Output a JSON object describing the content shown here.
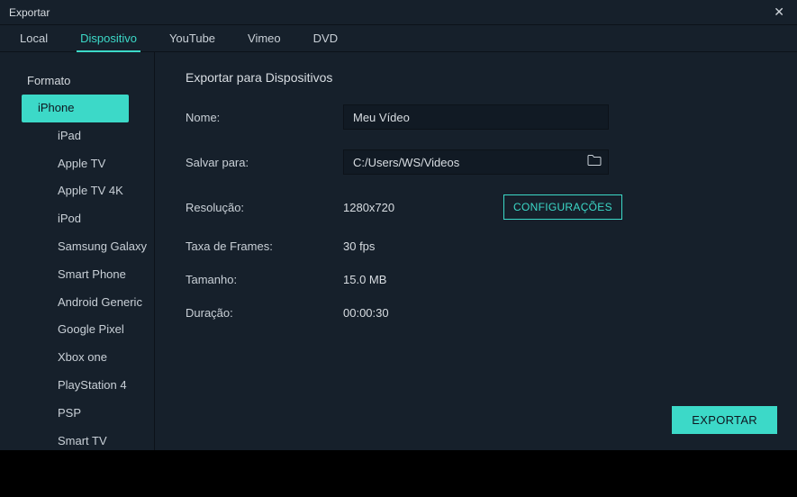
{
  "window": {
    "title": "Exportar"
  },
  "tabs": {
    "local": "Local",
    "device": "Dispositivo",
    "youtube": "YouTube",
    "vimeo": "Vimeo",
    "dvd": "DVD"
  },
  "sidebar": {
    "heading": "Formato",
    "items": [
      "iPhone",
      "iPad",
      "Apple TV",
      "Apple TV 4K",
      "iPod",
      "Samsung Galaxy",
      "Smart Phone",
      "Android Generic",
      "Google Pixel",
      "Xbox one",
      "PlayStation 4",
      "PSP",
      "Smart TV"
    ]
  },
  "main": {
    "section_title": "Exportar para Dispositivos",
    "name_label": "Nome:",
    "name_value": "Meu Vídeo",
    "save_label": "Salvar para:",
    "save_value": "C:/Users/WS/Videos",
    "resolution_label": "Resolução:",
    "resolution_value": "1280x720",
    "settings_btn": "CONFIGURAÇÕES",
    "framerate_label": "Taxa de Frames:",
    "framerate_value": "30 fps",
    "size_label": "Tamanho:",
    "size_value": "15.0 MB",
    "duration_label": "Duração:",
    "duration_value": "00:00:30",
    "export_btn": "EXPORTAR"
  }
}
